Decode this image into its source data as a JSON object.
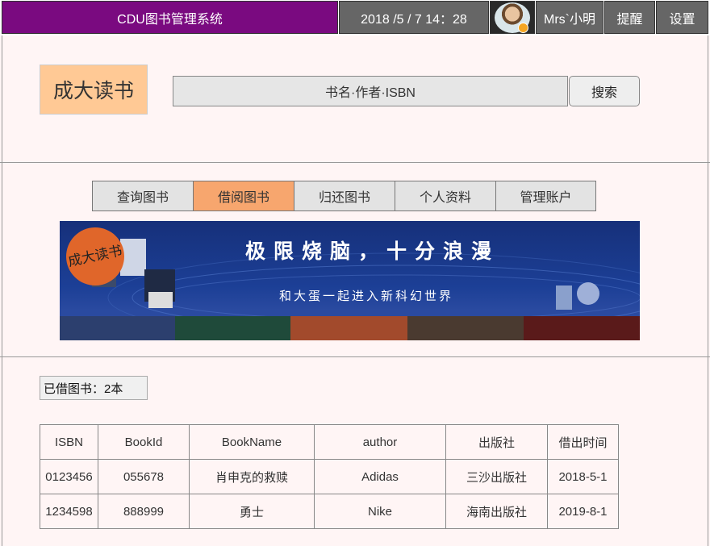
{
  "topbar": {
    "title": "CDU图书管理系统",
    "datetime": "2018 /5 / 7 14：28",
    "username": "Mrs`小明",
    "remind_label": "提醒",
    "settings_label": "设置"
  },
  "header": {
    "logo_text": "成大读书",
    "search_placeholder": "书名·作者·ISBN",
    "search_button": "搜索"
  },
  "nav": {
    "tabs": [
      {
        "label": "查询图书"
      },
      {
        "label": "借阅图书"
      },
      {
        "label": "归还图书"
      },
      {
        "label": "个人资料"
      },
      {
        "label": "管理账户"
      }
    ],
    "active_index": 1
  },
  "banner": {
    "badge_text": "成大读书",
    "title": "极限烧脑，十分浪漫",
    "subtitle": "和大蛋一起进入新科幻世界"
  },
  "borrowed": {
    "label": "已借图书：2本"
  },
  "table": {
    "headers": [
      "ISBN",
      "BookId",
      "BookName",
      "author",
      "出版社",
      "借出时间"
    ],
    "rows": [
      [
        "0123456",
        "055678",
        "肖申克的救赎",
        "Adidas",
        "三沙出版社",
        "2018-5-1"
      ],
      [
        "1234598",
        "888999",
        "勇士",
        "Nike",
        "海南出版社",
        "2019-8-1"
      ]
    ]
  },
  "colors": {
    "title_bg": "#7a0a80",
    "topbar_bg": "#666666",
    "active_tab": "#f7a66e",
    "logo_bg": "#ffc995"
  }
}
